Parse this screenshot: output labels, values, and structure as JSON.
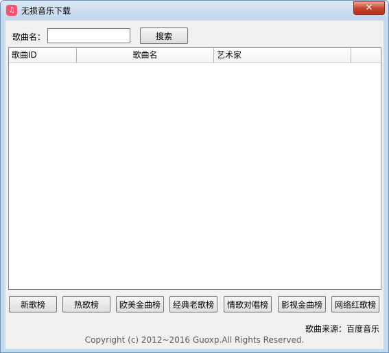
{
  "window": {
    "title": "无损音乐下载",
    "close_symbol": "✕"
  },
  "search": {
    "label": "歌曲名：",
    "value": "",
    "placeholder": "",
    "button_label": "搜索"
  },
  "table": {
    "columns": [
      "歌曲ID",
      "歌曲名",
      "艺术家"
    ],
    "rows": []
  },
  "charts": [
    {
      "id": "new",
      "label": "新歌榜"
    },
    {
      "id": "hot",
      "label": "热歌榜"
    },
    {
      "id": "western",
      "label": "欧美金曲榜"
    },
    {
      "id": "classic",
      "label": "经典老歌榜"
    },
    {
      "id": "duet",
      "label": "情歌对唱榜"
    },
    {
      "id": "film",
      "label": "影视金曲榜"
    },
    {
      "id": "internet",
      "label": "网络红歌榜"
    }
  ],
  "footer": {
    "source": "歌曲来源：百度音乐",
    "copyright": "Copyright (c)  2012~2016 Guoxp.All Rights Reserved."
  }
}
